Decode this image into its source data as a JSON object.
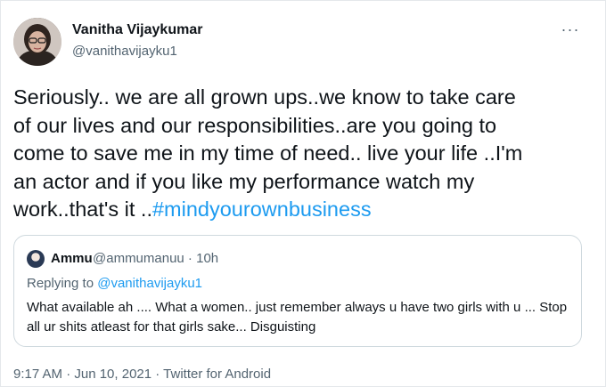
{
  "tweet": {
    "author_name": "Vanitha Vijaykumar",
    "author_handle": "@vanithavijayku1",
    "more_label": "···",
    "text_main": "Seriously.. we are all grown ups..we know to take care\nof our lives and our responsibilities..are you going to\ncome to save me in my time of need.. live your life ..I'm\nan actor and if you like my performance watch my\nwork..that's it ..",
    "hashtag": "#mindyourownbusiness",
    "timestamp": "9:17 AM · Jun 10, 2021 · Twitter for Android"
  },
  "quoted": {
    "author_name": "Ammu",
    "author_meta": "@ammumanuu · 10h",
    "replying_prefix": "Replying to ",
    "replying_handle": "@vanithavijayku1",
    "text": "What available ah .... What a women.. just remember always u have two girls with u ... Stop all ur shits atleast for that girls sake... Disguisting"
  },
  "colors": {
    "link": "#1d9bf0",
    "secondary_text": "#536471",
    "border": "#cfd9de"
  },
  "icons": {
    "more": "more-horizontal-icon"
  }
}
